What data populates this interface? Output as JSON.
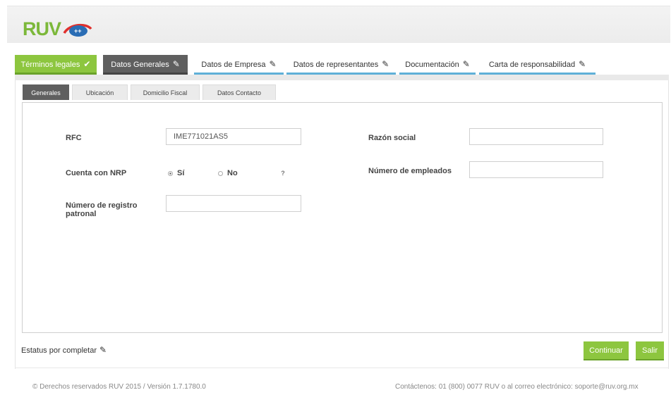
{
  "brand": {
    "logo_text": "RUV",
    "logo_mark_text": "++"
  },
  "main_tabs": [
    {
      "label": "Términos legales",
      "state": "done",
      "icon": "check-icon"
    },
    {
      "label": "Datos Generales",
      "state": "active",
      "icon": "pencil-icon"
    },
    {
      "label": "Datos de Empresa",
      "state": "todo",
      "icon": "pencil-icon"
    },
    {
      "label": "Datos de representantes",
      "state": "todo",
      "icon": "pencil-icon"
    },
    {
      "label": "Documentación",
      "state": "todo",
      "icon": "pencil-icon"
    },
    {
      "label": "Carta de responsabilidad",
      "state": "todo",
      "icon": "pencil-icon"
    }
  ],
  "sub_tabs": [
    {
      "label": "Generales",
      "active": true
    },
    {
      "label": "Ubicación",
      "active": false
    },
    {
      "label": "Domicilio Fiscal",
      "active": false
    },
    {
      "label": "Datos Contacto",
      "active": false
    }
  ],
  "form": {
    "rfc_label": "RFC",
    "rfc_value": "IME771021AS5",
    "razon_social_label": "Razón social",
    "razon_social_value": "",
    "nrp_label": "Cuenta con NRP",
    "nrp_yes": "Sí",
    "nrp_no": "No",
    "nrp_selected": "Sí",
    "help_text": "?",
    "empleados_label": "Número de empleados",
    "empleados_value": "",
    "registro_label_line1": "Número de registro",
    "registro_label_line2": "patronal",
    "registro_value": ""
  },
  "status": {
    "text": "Estatus por completar",
    "icon": "pencil-icon"
  },
  "buttons": {
    "continuar": "Continuar",
    "salir": "Salir"
  },
  "footer": {
    "left": "© Derechos reservados RUV 2015 / Versión 1.7.1780.0",
    "right": "Contáctenos: 01 (800) 0077 RUV o al correo electrónico: soporte@ruv.org.mx"
  },
  "colors": {
    "green": "#8dc63f",
    "dark_tab": "#5f5f5f",
    "blue_underline": "#5fb0d8"
  }
}
